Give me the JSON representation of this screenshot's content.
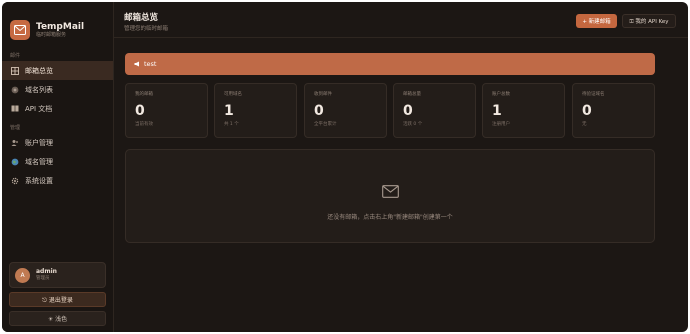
{
  "brand": {
    "name": "TempMail",
    "subtitle": "临时邮箱服务"
  },
  "sidebar": {
    "section_mail": "邮件",
    "section_manage": "管理",
    "items": [
      {
        "label": "邮箱总览",
        "icon": "grid-icon",
        "active": true
      },
      {
        "label": "域名列表",
        "icon": "globe-icon"
      },
      {
        "label": "API 文档",
        "icon": "book-icon"
      },
      {
        "label": "账户管理",
        "icon": "users-icon"
      },
      {
        "label": "域名管理",
        "icon": "globe-color-icon"
      },
      {
        "label": "系统设置",
        "icon": "gear-icon"
      }
    ],
    "user": {
      "avatar_initial": "A",
      "name": "admin",
      "role": "管理员"
    },
    "logout_label": "⎋ 退出登录",
    "theme_label": "☀ 浅色"
  },
  "header": {
    "title": "邮箱总览",
    "subtitle": "管理您的临时邮箱",
    "new_mailbox_label": "+ 新建邮箱",
    "api_key_label": "⚿ 我的 API Key"
  },
  "banner": {
    "text": "test"
  },
  "stats": [
    {
      "label": "我的邮箱",
      "value": "0",
      "note": "当前有效"
    },
    {
      "label": "可用域名",
      "value": "1",
      "note": "共 1 个"
    },
    {
      "label": "收到邮件",
      "value": "0",
      "note": "全平台累计"
    },
    {
      "label": "邮箱总量",
      "value": "0",
      "note": "活跃 0 个"
    },
    {
      "label": "账户总数",
      "value": "1",
      "note": "注册用户"
    },
    {
      "label": "待验证域名",
      "value": "0",
      "note": "无"
    }
  ],
  "empty_state": {
    "icon": "envelope-icon",
    "text": "还没有邮箱，点击右上角\"新建邮箱\"创建第一个"
  },
  "colors": {
    "accent": "#c4673f",
    "background": "#1c1714",
    "card": "#231d19"
  }
}
